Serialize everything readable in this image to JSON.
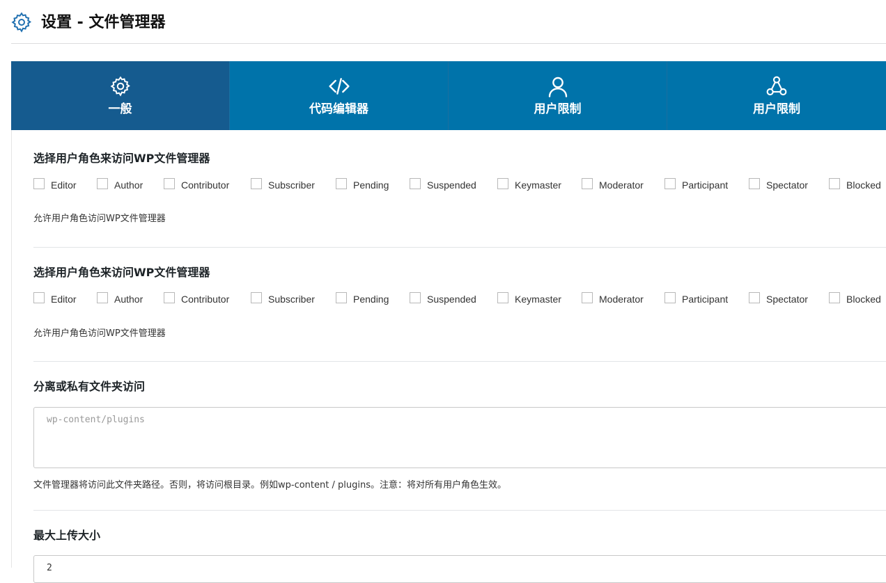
{
  "header": {
    "title": "设置 - 文件管理器",
    "icon": "gear-icon"
  },
  "tabs": [
    {
      "label": "一般",
      "icon": "gear-icon",
      "active": true
    },
    {
      "label": "代码编辑器",
      "icon": "code-icon",
      "active": false
    },
    {
      "label": "用户限制",
      "icon": "user-icon",
      "active": false
    },
    {
      "label": "用户限制",
      "icon": "nodes-icon",
      "active": false
    }
  ],
  "colors": {
    "tab_bar": "#0073aa",
    "tab_active": "#155b8f",
    "icon_blue": "#2271b1"
  },
  "sections": [
    {
      "title": "选择用户角色来访问WP文件管理器",
      "roles": [
        "Editor",
        "Author",
        "Contributor",
        "Subscriber",
        "Pending",
        "Suspended",
        "Keymaster",
        "Moderator",
        "Participant",
        "Spectator",
        "Blocked"
      ],
      "description": "允许用户角色访问WP文件管理器"
    },
    {
      "title": "选择用户角色来访问WP文件管理器",
      "roles": [
        "Editor",
        "Author",
        "Contributor",
        "Subscriber",
        "Pending",
        "Suspended",
        "Keymaster",
        "Moderator",
        "Participant",
        "Spectator",
        "Blocked"
      ],
      "description": "允许用户角色访问WP文件管理器"
    }
  ],
  "folder_access": {
    "title": "分离或私有文件夹访问",
    "placeholder": "wp-content/plugins",
    "description": "文件管理器将访问此文件夹路径。否则，将访问根目录。例如wp-content / plugins。注意：将对所有用户角色生效。"
  },
  "upload": {
    "title": "最大上传大小",
    "value": "2"
  }
}
